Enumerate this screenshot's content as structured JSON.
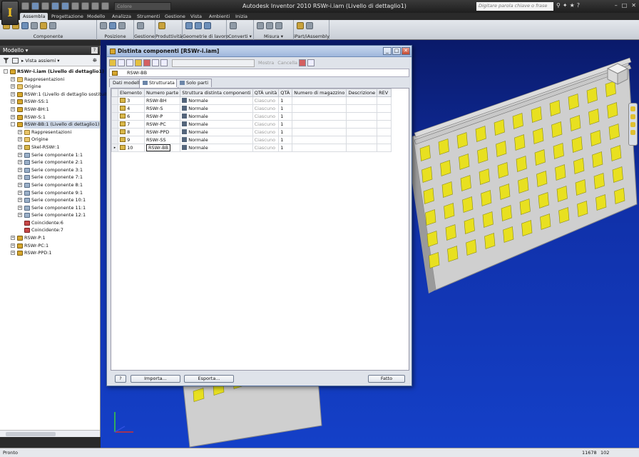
{
  "titlebar": {
    "app_menu_icon": "inventor-logo-icon",
    "color_select": "Colore",
    "title": "Autodesk Inventor 2010   RSWr-i.iam (Livello di dettaglio1)",
    "search_placeholder": "Digitare parola chiave o frase"
  },
  "ribbon": {
    "tabs": [
      "Assembla",
      "Progettazione",
      "Modello",
      "Analizza",
      "Strumenti",
      "Gestione",
      "Vista",
      "Ambienti",
      "Inizia"
    ],
    "active_tab": "Assembla",
    "panels": [
      "Componente",
      "Posizione",
      "Gestione",
      "Produttività",
      "Geometrie di lavoro",
      "Converti ▾",
      "Misura ▾",
      "iPart/iAssembly"
    ]
  },
  "browser": {
    "title": "Modello ▾",
    "help": "?",
    "view_label": "Vista assiemi",
    "items": [
      {
        "label": "RSWr-i.iam (Livello di dettaglio1)",
        "icon": "assembly-icon",
        "indent": 0,
        "exp": "-",
        "root": true
      },
      {
        "label": "Rappresentazioni",
        "icon": "folder-icon",
        "indent": 1,
        "exp": "+"
      },
      {
        "label": "Origine",
        "icon": "folder-icon",
        "indent": 1,
        "exp": "+"
      },
      {
        "label": "RSWr:1 (Livello di dettaglio sostituito1)",
        "icon": "assembly-icon",
        "indent": 1,
        "exp": "+"
      },
      {
        "label": "RSWr-SS:1",
        "icon": "assembly-icon",
        "indent": 1,
        "exp": "+"
      },
      {
        "label": "RSWr-BH:1",
        "icon": "assembly-icon",
        "indent": 1,
        "exp": "+"
      },
      {
        "label": "RSWr-S:1",
        "icon": "assembly-icon",
        "indent": 1,
        "exp": "+"
      },
      {
        "label": "RSWr-BB:1 (Livello di dettaglio1)",
        "icon": "assembly-icon",
        "indent": 1,
        "exp": "-",
        "selected": true
      },
      {
        "label": "Rappresentazioni",
        "icon": "folder-icon",
        "indent": 2,
        "exp": "+"
      },
      {
        "label": "Origine",
        "icon": "folder-icon",
        "indent": 2,
        "exp": "+"
      },
      {
        "label": "Skel-RSWr:1",
        "icon": "part-icon",
        "indent": 2,
        "exp": "+"
      },
      {
        "label": "Serie componente 1:1",
        "icon": "pattern-icon",
        "indent": 2,
        "exp": "+"
      },
      {
        "label": "Serie componente 2:1",
        "icon": "pattern-icon",
        "indent": 2,
        "exp": "+"
      },
      {
        "label": "Serie componente 3:1",
        "icon": "pattern-icon",
        "indent": 2,
        "exp": "+"
      },
      {
        "label": "Serie componente 7:1",
        "icon": "pattern-icon",
        "indent": 2,
        "exp": "+"
      },
      {
        "label": "Serie componente 8:1",
        "icon": "pattern-icon",
        "indent": 2,
        "exp": "+"
      },
      {
        "label": "Serie componente 9:1",
        "icon": "pattern-icon",
        "indent": 2,
        "exp": "+"
      },
      {
        "label": "Serie componente 10:1",
        "icon": "pattern-icon",
        "indent": 2,
        "exp": "+"
      },
      {
        "label": "Serie componente 11:1",
        "icon": "pattern-icon",
        "indent": 2,
        "exp": "+"
      },
      {
        "label": "Serie componente 12:1",
        "icon": "pattern-icon",
        "indent": 2,
        "exp": "+"
      },
      {
        "label": "Coincidente:6",
        "icon": "constraint-icon",
        "indent": 2,
        "exp": ""
      },
      {
        "label": "Coincidente:7",
        "icon": "constraint-icon",
        "indent": 2,
        "exp": ""
      },
      {
        "label": "RSWr-P:1",
        "icon": "assembly-icon",
        "indent": 1,
        "exp": "+"
      },
      {
        "label": "RSWr-PC:1",
        "icon": "assembly-icon",
        "indent": 1,
        "exp": "+"
      },
      {
        "label": "RSWr-PPD:1",
        "icon": "assembly-icon",
        "indent": 1,
        "exp": "+"
      }
    ]
  },
  "dialog": {
    "title": "Distinta componenti [RSWr-i.iam]",
    "toolbar_mostra": "Mostra",
    "toolbar_cancella": "Cancella",
    "bom_name": "RSWr-BB",
    "tabs": [
      "Dati modello",
      "Strutturata",
      "Solo parti"
    ],
    "active_tab": "Strutturata",
    "columns": [
      "Elemento",
      "Numero parte",
      "Struttura distinta componenti",
      "QTÀ unità",
      "QTÀ",
      "Numero di magazzino",
      "Descrizione",
      "REV"
    ],
    "rows": [
      {
        "item": "3",
        "part": "RSWr-BH",
        "structure": "Normale",
        "unit_qty": "Ciascuno",
        "qty": "1"
      },
      {
        "item": "4",
        "part": "RSWr-S",
        "structure": "Normale",
        "unit_qty": "Ciascuno",
        "qty": "1"
      },
      {
        "item": "6",
        "part": "RSWr-P",
        "structure": "Normale",
        "unit_qty": "Ciascuno",
        "qty": "1"
      },
      {
        "item": "7",
        "part": "RSWr-PC",
        "structure": "Normale",
        "unit_qty": "Ciascuno",
        "qty": "1"
      },
      {
        "item": "8",
        "part": "RSWr-PPD",
        "structure": "Normale",
        "unit_qty": "Ciascuno",
        "qty": "1"
      },
      {
        "item": "9",
        "part": "RSWr-SS",
        "structure": "Normale",
        "unit_qty": "Ciascuno",
        "qty": "1"
      },
      {
        "item": "10",
        "part": "RSWr-BB",
        "structure": "Normale",
        "unit_qty": "Ciascuno",
        "qty": "1",
        "current": true
      }
    ],
    "buttons": {
      "help": "?",
      "import": "Importa...",
      "export": "Esporta...",
      "done": "Fatto"
    }
  },
  "statusbar": {
    "status": "Pronto",
    "count1": "11678",
    "count2": "102"
  },
  "colors": {
    "viewport_top": "#0a1a6a",
    "viewport_bottom": "#1440c8",
    "panel_yellow": "#e8e020",
    "wall_gray": "#d0d0d0"
  }
}
